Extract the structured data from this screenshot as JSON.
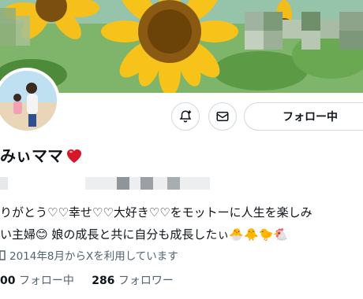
{
  "profile": {
    "display_name": "みぃママ",
    "name_emoji": "❤️",
    "bio_line1": "りがとう♡♡幸せ♡♡大好き♡♡をモットーに人生を楽しみ",
    "bio_line2": "い主婦😊 娘の成長と共に自分も成長したぃ🐣🐥🐤🐔",
    "joined": "2014年8月からXを利用しています",
    "following_count": "00",
    "following_label": "フォロー中",
    "followers_count": "286",
    "followers_label": "フォロワー"
  },
  "actions": {
    "follow_label": "フォロー中",
    "notify_icon": "bell-plus-icon",
    "message_icon": "envelope-icon"
  },
  "colors": {
    "text": "#0f1419",
    "secondary": "#536471",
    "border": "#cfd9de"
  }
}
